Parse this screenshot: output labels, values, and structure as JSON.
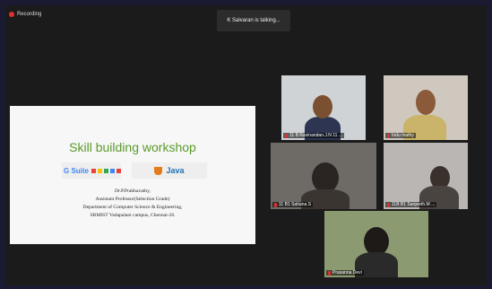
{
  "recording": {
    "label": "Recording",
    "color": "#e03030"
  },
  "speaker_banner": {
    "text": "K Saivaran is talking..."
  },
  "shared_slide": {
    "title": "Skill building workshop",
    "logos": {
      "gsuite": "G Suite",
      "java": "Java"
    },
    "presenter_lines": [
      "Dr.P.Prabhavathy,",
      "Assistant Professor(Selection Grade)",
      "Department of Computer Science & Engineering,",
      "SRMIST Vadapalani campus, Chennai-26."
    ]
  },
  "participants": [
    {
      "name": "11 B Ravinandan.J.N 11 ..."
    },
    {
      "name": "Indu mathy"
    },
    {
      "name": "11 B1 Sahana.S"
    },
    {
      "name": "11B B1 Sanjeeth.M ..."
    },
    {
      "name": "Prasanna Devi"
    }
  ]
}
